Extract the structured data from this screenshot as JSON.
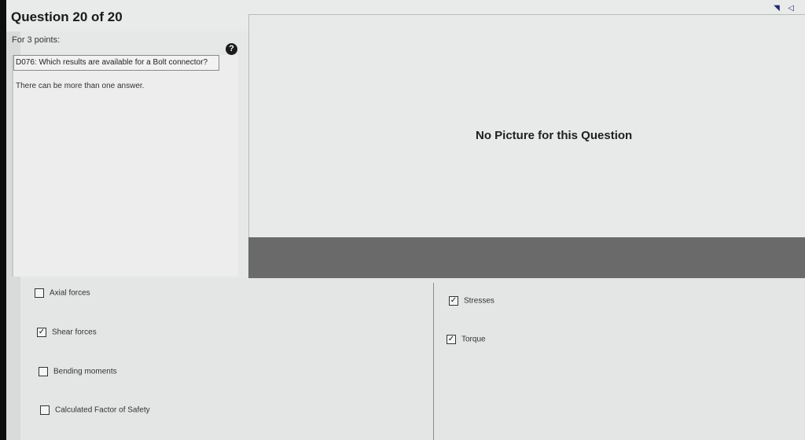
{
  "header": {
    "title": "Question 20 of 20"
  },
  "question": {
    "points_label": "For 3 points:",
    "help_symbol": "?",
    "text": "D076: Which results are available for a Bolt connector?",
    "hint": "There can be more than one answer."
  },
  "picture_area": {
    "message": "No Picture for this Question"
  },
  "options_left": [
    {
      "label": "Axial forces",
      "checked": false
    },
    {
      "label": "Shear forces",
      "checked": true
    },
    {
      "label": "Bending moments",
      "checked": false
    },
    {
      "label": "Calculated Factor of Safety",
      "checked": false
    }
  ],
  "options_right": [
    {
      "label": "Stresses",
      "checked": true
    },
    {
      "label": "Torque",
      "checked": true
    }
  ],
  "system_tray": {
    "icons": [
      "wifi-icon",
      "volume-icon"
    ]
  }
}
